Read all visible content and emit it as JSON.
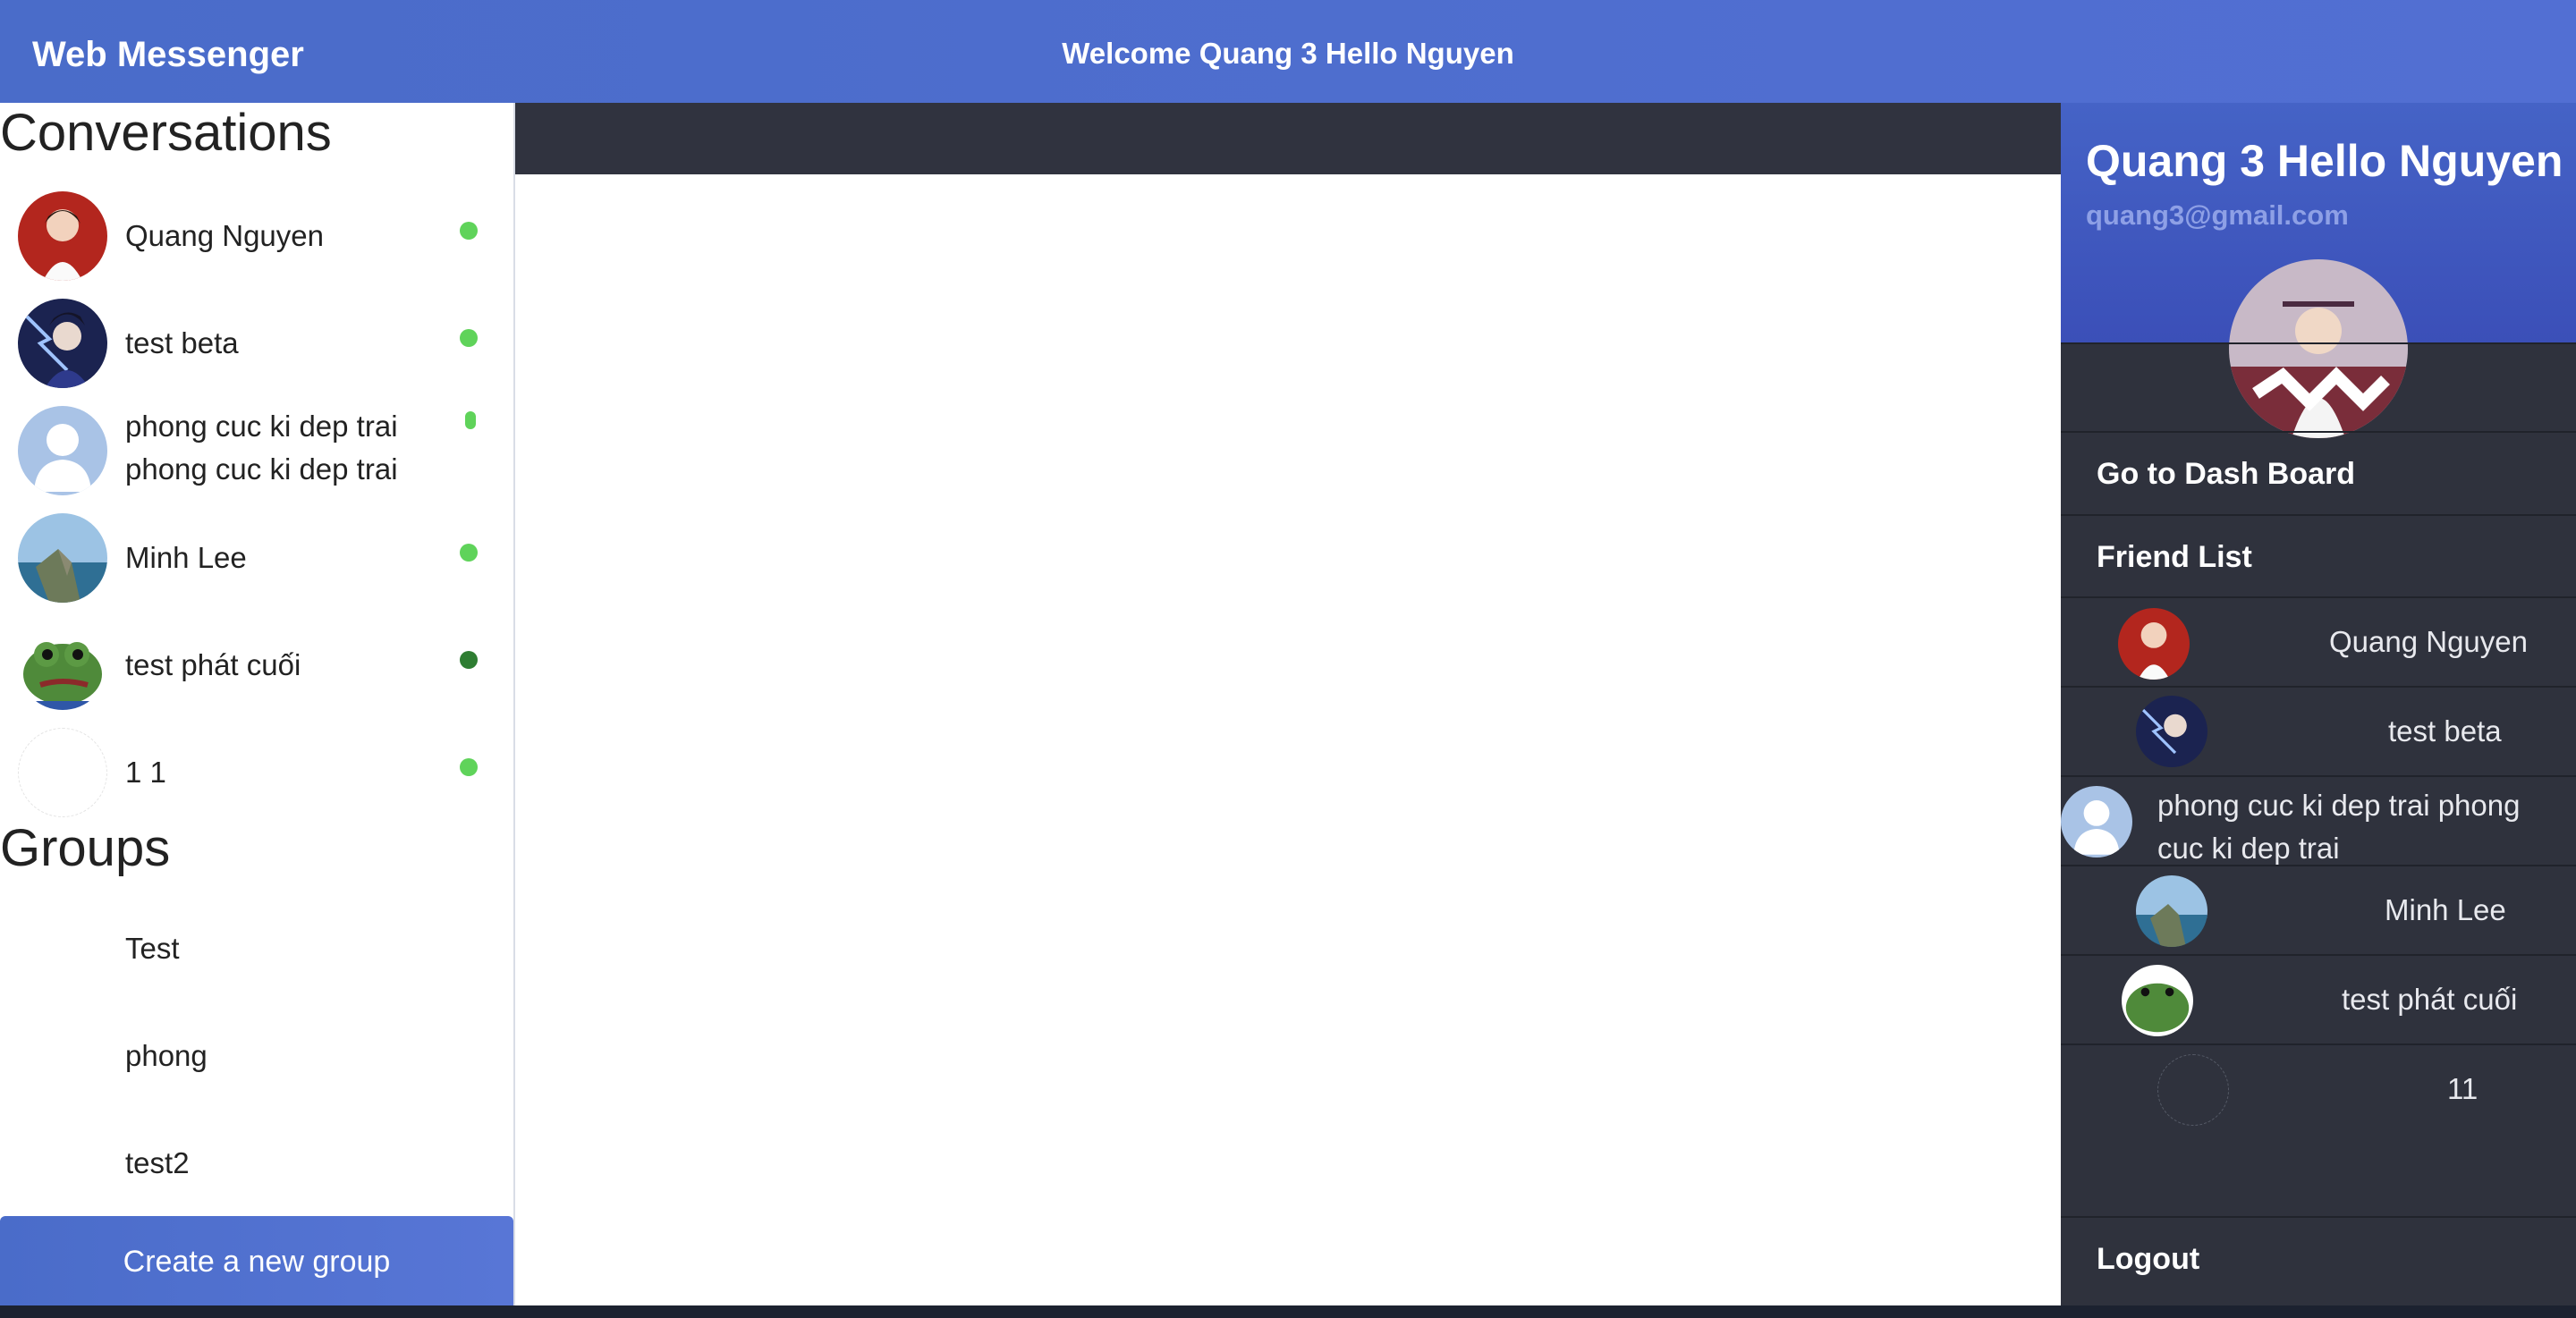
{
  "header": {
    "brand": "Web Messenger",
    "welcome": "Welcome Quang 3 Hello Nguyen"
  },
  "conversations": {
    "title": "Conversations",
    "items": [
      {
        "name": "Quang Nguyen",
        "online": true
      },
      {
        "name": "test beta",
        "online": true
      },
      {
        "name": "phong cuc ki dep trai phong cuc ki dep trai",
        "online": true
      },
      {
        "name": "Minh Lee",
        "online": true
      },
      {
        "name": "test phát cuối",
        "online": true
      },
      {
        "name": "1 1",
        "online": true
      }
    ]
  },
  "groups": {
    "title": "Groups",
    "items": [
      "Test",
      "phong",
      "test2"
    ],
    "create_label": "Create a new group"
  },
  "profile": {
    "name": "Quang 3 Hello Nguyen",
    "email": "quang3@gmail.com"
  },
  "menu": {
    "dashboard": "Go to Dash Board",
    "friend_list": "Friend List",
    "logout": "Logout"
  },
  "friends": [
    "Quang Nguyen",
    "test beta",
    "phong cuc ki dep trai phong cuc ki dep trai",
    "Minh Lee",
    "test phát cuối",
    "11"
  ],
  "colors": {
    "primary": "#4a6cc9",
    "sidebar": "#2f323d",
    "online": "#5fd35a",
    "online_dark": "#2e7d32"
  }
}
